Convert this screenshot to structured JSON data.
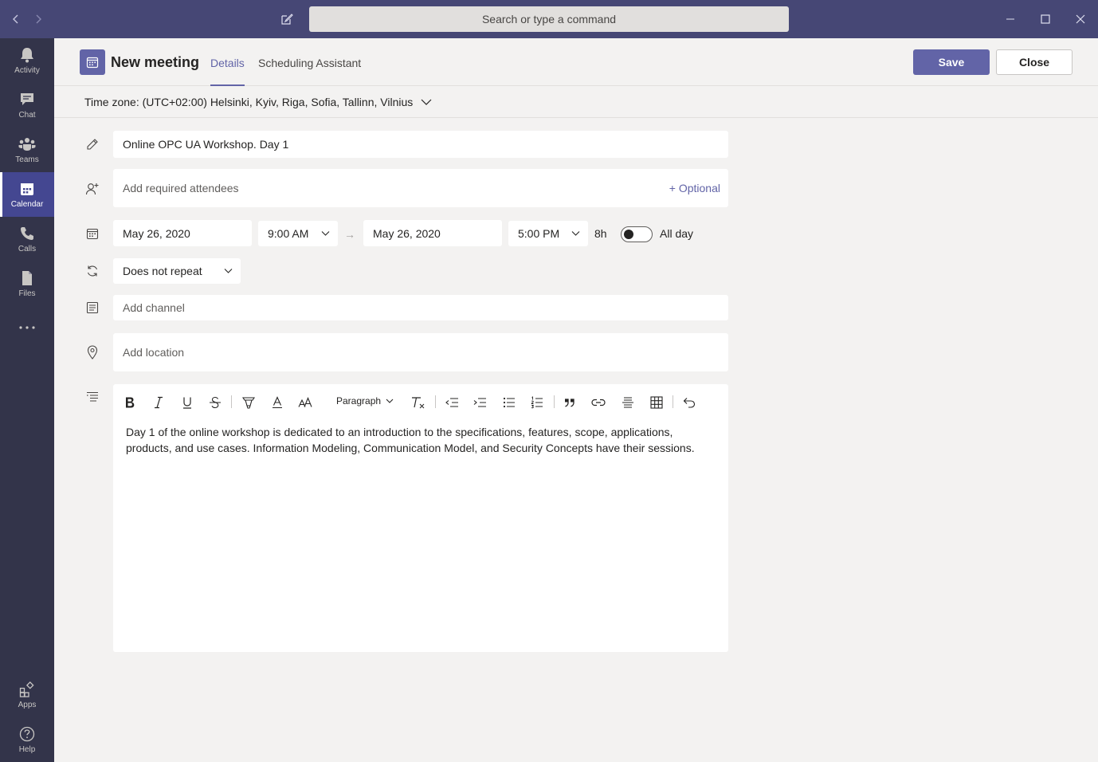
{
  "titlebar": {
    "search_placeholder": "Search or type a command"
  },
  "rail": {
    "items": [
      {
        "label": "Activity",
        "icon": "bell-icon"
      },
      {
        "label": "Chat",
        "icon": "chat-icon"
      },
      {
        "label": "Teams",
        "icon": "teams-icon"
      },
      {
        "label": "Calendar",
        "icon": "calendar-icon",
        "active": true
      },
      {
        "label": "Calls",
        "icon": "phone-icon"
      },
      {
        "label": "Files",
        "icon": "file-icon"
      }
    ],
    "bottom": [
      {
        "label": "Apps",
        "icon": "apps-icon"
      },
      {
        "label": "Help",
        "icon": "help-icon"
      }
    ]
  },
  "header": {
    "title": "New meeting",
    "tabs": [
      {
        "label": "Details",
        "active": true
      },
      {
        "label": "Scheduling Assistant",
        "active": false
      }
    ],
    "save_label": "Save",
    "close_label": "Close"
  },
  "timezone": {
    "label": "Time zone: (UTC+02:00) Helsinki, Kyiv, Riga, Sofia, Tallinn, Vilnius"
  },
  "form": {
    "title_value": "Online OPC UA Workshop. Day 1",
    "attendees_placeholder": "Add required attendees",
    "optional_label": "+ Optional",
    "start_date": "May 26, 2020",
    "start_time": "9:00 AM",
    "end_date": "May 26, 2020",
    "end_time": "5:00 PM",
    "duration": "8h",
    "arrow": "→",
    "all_day_label": "All day",
    "all_day_on": false,
    "repeat": "Does not repeat",
    "channel_placeholder": "Add channel",
    "location_placeholder": "Add location"
  },
  "editor": {
    "paragraph_label": "Paragraph",
    "body": "Day 1 of the online workshop is dedicated to an introduction to the specifications, features, scope, applications, products, and use cases. Information Modeling, Communication Model, and Security Concepts have their sessions."
  },
  "colors": {
    "accent": "#6264a7",
    "titlebar": "#464775",
    "rail": "#33344a",
    "background": "#f3f2f1"
  }
}
